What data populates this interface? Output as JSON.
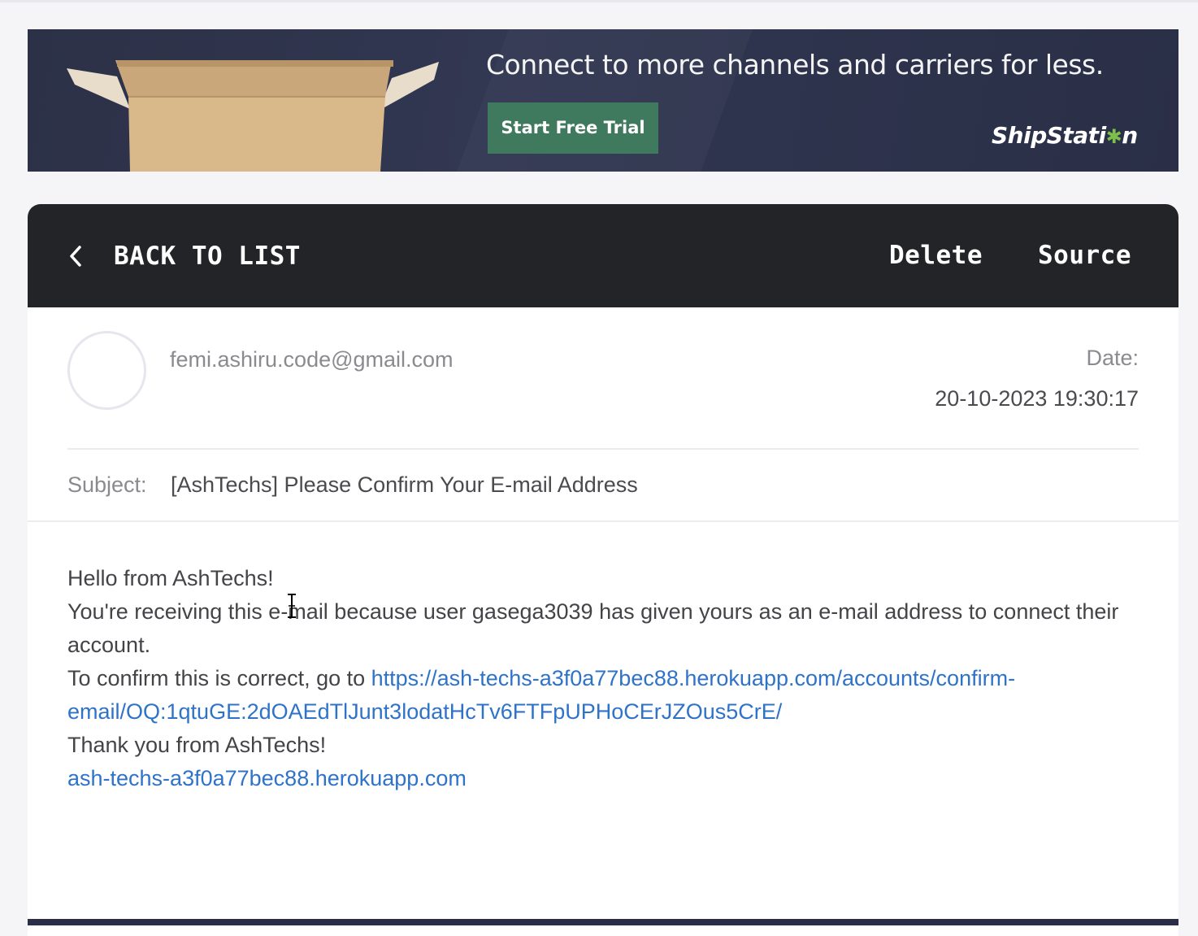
{
  "ad": {
    "headline": "Connect to more channels and carriers for less.",
    "cta_label": "Start Free Trial",
    "brand_prefix": "ShipStati",
    "brand_suffix": "n",
    "brand_gear": "✱",
    "colors": {
      "background": "#2c3147",
      "cta": "#3f7a5e",
      "gear": "#7cc04b"
    }
  },
  "toolbar": {
    "back_label": "BACK TO LIST",
    "delete_label": "Delete",
    "source_label": "Source",
    "back_icon": "chevron-left-icon"
  },
  "message": {
    "sender": "femi.ashiru.code@gmail.com",
    "date_label": "Date:",
    "date_value": "20-10-2023 19:30:17",
    "subject_label": "Subject:",
    "subject": "[AshTechs] Please Confirm Your E-mail Address",
    "body": {
      "greeting": "Hello from AshTechs!",
      "line1": "You're receiving this e-mail because user gasega3039 has given yours as an e-mail address to connect their account.",
      "confirm_prefix": "To confirm this is correct, go to ",
      "confirm_link": "https://ash-techs-a3f0a77bec88.herokuapp.com/accounts/confirm-email/OQ:1qtuGE:2dOAEdTlJunt3lodatHcTv6FTFpUPHoCErJZOus5CrE/",
      "thanks": "Thank you from AshTechs!",
      "site_link": "ash-techs-a3f0a77bec88.herokuapp.com"
    }
  }
}
